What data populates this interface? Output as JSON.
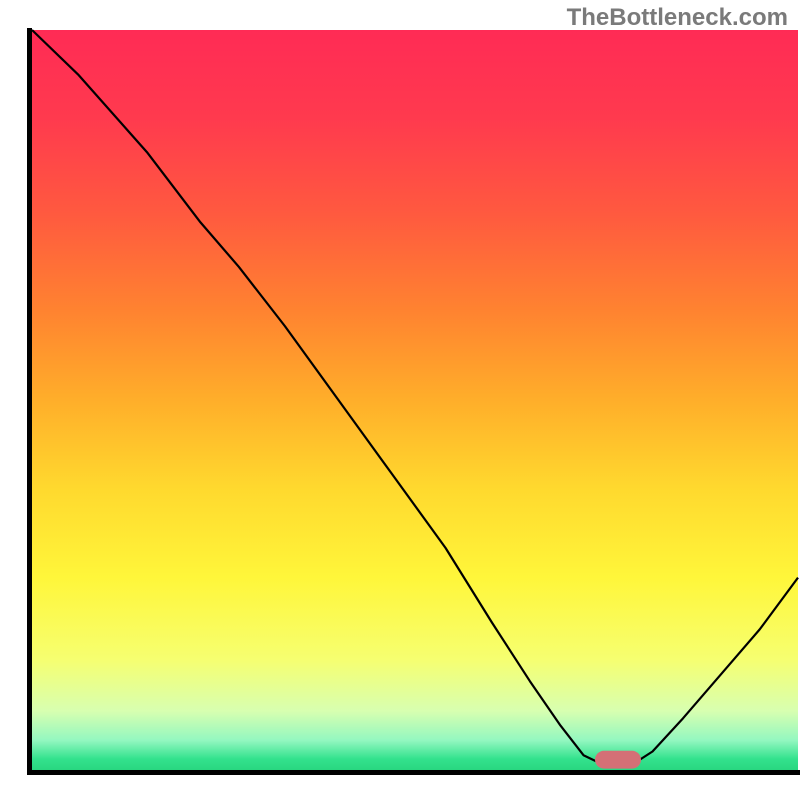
{
  "watermark": "TheBottleneck.com",
  "chart_data": {
    "type": "line",
    "title": "",
    "xlabel": "",
    "ylabel": "",
    "xlim": [
      0,
      100
    ],
    "ylim": [
      0,
      100
    ],
    "grid": false,
    "legend": false,
    "background_gradient_stops": [
      {
        "offset": 0.0,
        "color": "#ff2b55"
      },
      {
        "offset": 0.12,
        "color": "#ff3a4e"
      },
      {
        "offset": 0.25,
        "color": "#ff5a3f"
      },
      {
        "offset": 0.38,
        "color": "#ff8330"
      },
      {
        "offset": 0.5,
        "color": "#ffae2a"
      },
      {
        "offset": 0.62,
        "color": "#ffd92e"
      },
      {
        "offset": 0.74,
        "color": "#fff63a"
      },
      {
        "offset": 0.85,
        "color": "#f6ff70"
      },
      {
        "offset": 0.92,
        "color": "#d8ffb0"
      },
      {
        "offset": 0.96,
        "color": "#93f7c0"
      },
      {
        "offset": 0.985,
        "color": "#33e28d"
      },
      {
        "offset": 1.0,
        "color": "#29d780"
      }
    ],
    "series": [
      {
        "name": "bottleneck-curve",
        "color": "#000000",
        "width": 2.2,
        "x": [
          0.0,
          6.0,
          15.0,
          22.0,
          27.0,
          33.0,
          40.0,
          47.0,
          54.0,
          60.0,
          65.0,
          69.0,
          72.0,
          75.0,
          78.0,
          81.0,
          85.0,
          90.0,
          95.0,
          100.0
        ],
        "y": [
          100.0,
          94.0,
          83.5,
          74.0,
          68.0,
          60.0,
          50.0,
          40.0,
          30.0,
          20.0,
          12.0,
          6.0,
          2.0,
          0.5,
          0.5,
          2.5,
          7.0,
          13.0,
          19.0,
          26.0
        ]
      }
    ],
    "marker": {
      "name": "optimal-zone",
      "shape": "rounded-rect",
      "color": "#d47076",
      "x_center": 76.5,
      "y_center": 1.4,
      "width": 6.0,
      "height": 2.4
    },
    "axes": {
      "black_border_sides": [
        "left",
        "bottom"
      ],
      "border_width": 5
    }
  }
}
